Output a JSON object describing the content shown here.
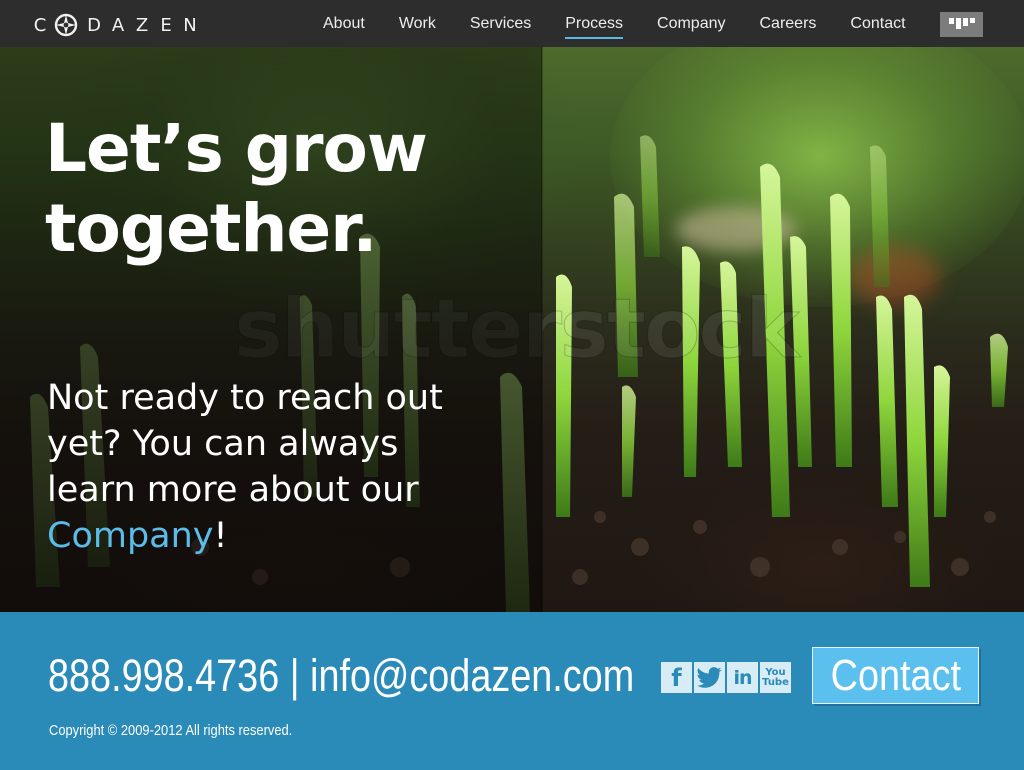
{
  "header": {
    "logo_letters": [
      "C",
      "D",
      "A",
      "Z",
      "E",
      "N"
    ],
    "nav": [
      {
        "label": "About",
        "active": false
      },
      {
        "label": "Work",
        "active": false
      },
      {
        "label": "Services",
        "active": false
      },
      {
        "label": "Process",
        "active": true
      },
      {
        "label": "Company",
        "active": false
      },
      {
        "label": "Careers",
        "active": false
      },
      {
        "label": "Contact",
        "active": false
      }
    ],
    "badge_icon": "fist-icon"
  },
  "hero": {
    "headline_lines": [
      "Let’s grow",
      "together."
    ],
    "pitch_lines": [
      "Not ready to reach out",
      "yet? You can always",
      "learn more about our"
    ],
    "pitch_link": "Company",
    "pitch_end": "!",
    "watermark": "shutterstock"
  },
  "footer": {
    "contact_line": "888.998.4736 | info@codazen.com",
    "social": [
      {
        "name": "facebook-icon",
        "glyph": "f"
      },
      {
        "name": "twitter-icon",
        "glyph": "🐦"
      },
      {
        "name": "linkedin-icon",
        "glyph": "in"
      },
      {
        "name": "youtube-icon",
        "glyph_top": "You",
        "glyph_bottom": "Tube"
      }
    ],
    "contact_button": "Contact",
    "copyright": "Copyright © 2009-2012  All rights reserved."
  },
  "colors": {
    "header_bg": "#2d2d2d",
    "accent": "#58b9e6",
    "footer_bg": "#2a8ab8",
    "button_bg": "#5cc0ee"
  }
}
